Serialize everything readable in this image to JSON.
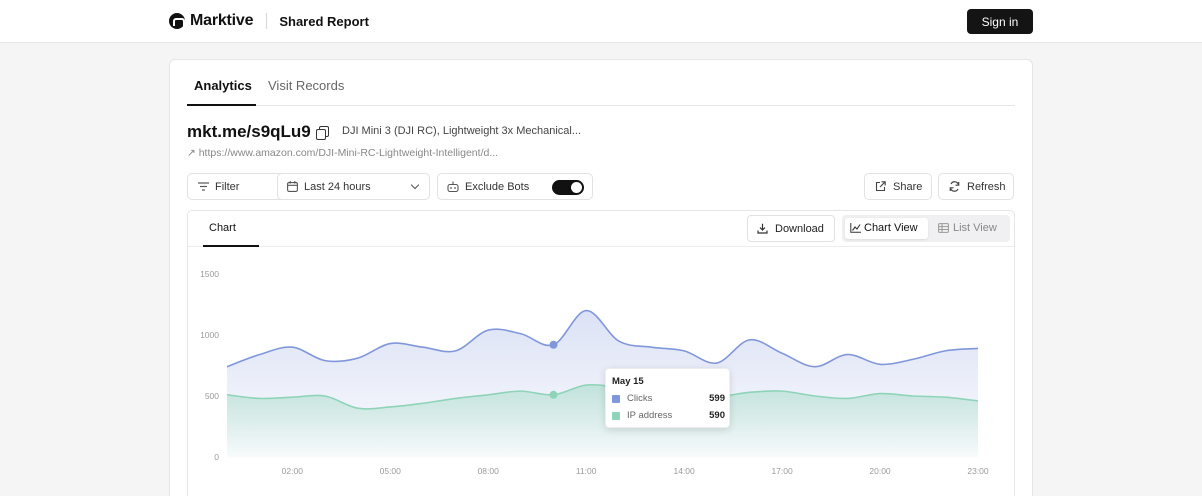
{
  "app": {
    "brand": "Marktive",
    "section": "Shared Report",
    "sign_in_label": "Sign in"
  },
  "tabs": [
    {
      "label": "Analytics",
      "active": true
    },
    {
      "label": "Visit Records",
      "active": false
    }
  ],
  "link": {
    "short_url": "mkt.me/s9qLu9",
    "title": "DJI Mini 3 (DJI RC), Lightweight 3x Mechanical...",
    "destination": "↗ https://www.amazon.com/DJI-Mini-RC-Lightweight-Intelligent/d..."
  },
  "controls": {
    "filter_label": "Filter",
    "range_label": "Last 24 hours",
    "exclude_bots_label": "Exclude Bots",
    "exclude_bots_on": true,
    "share_label": "Share",
    "refresh_label": "Refresh"
  },
  "panel": {
    "tab_label": "Chart",
    "download_label": "Download",
    "chart_view_label": "Chart View",
    "list_view_label": "List View",
    "active_view": "chart"
  },
  "colors": {
    "clicks": "#8197db",
    "ip": "#8fd4b8",
    "accent": "#111111"
  },
  "chart_data": {
    "type": "area",
    "x": [
      "00:00",
      "01:00",
      "02:00",
      "03:00",
      "04:00",
      "05:00",
      "06:00",
      "07:00",
      "08:00",
      "09:00",
      "10:00",
      "11:00",
      "12:00",
      "13:00",
      "14:00",
      "15:00",
      "16:00",
      "17:00",
      "18:00",
      "19:00",
      "20:00",
      "21:00",
      "22:00",
      "23:00"
    ],
    "x_ticks": [
      "02:00",
      "05:00",
      "08:00",
      "11:00",
      "14:00",
      "17:00",
      "20:00",
      "23:00"
    ],
    "y_ticks": [
      "0",
      "500",
      "1000",
      "1500"
    ],
    "ylim": [
      0,
      1500
    ],
    "grid": false,
    "series": [
      {
        "name": "Clicks",
        "color": "#8197db",
        "values": [
          740,
          840,
          900,
          790,
          810,
          930,
          900,
          870,
          1040,
          1010,
          920,
          1200,
          950,
          900,
          870,
          770,
          960,
          850,
          740,
          840,
          760,
          800,
          870,
          890
        ]
      },
      {
        "name": "IP address",
        "color": "#8fd4b8",
        "values": [
          510,
          480,
          490,
          500,
          400,
          410,
          440,
          480,
          510,
          540,
          510,
          590,
          570,
          530,
          560,
          500,
          530,
          540,
          500,
          480,
          520,
          500,
          490,
          460
        ]
      }
    ],
    "tooltip": {
      "date": "May 15",
      "rows": [
        {
          "name": "Clicks",
          "value": "599",
          "color": "#8197db"
        },
        {
          "name": "IP address",
          "value": "590",
          "color": "#8fd4b8"
        }
      ]
    }
  }
}
